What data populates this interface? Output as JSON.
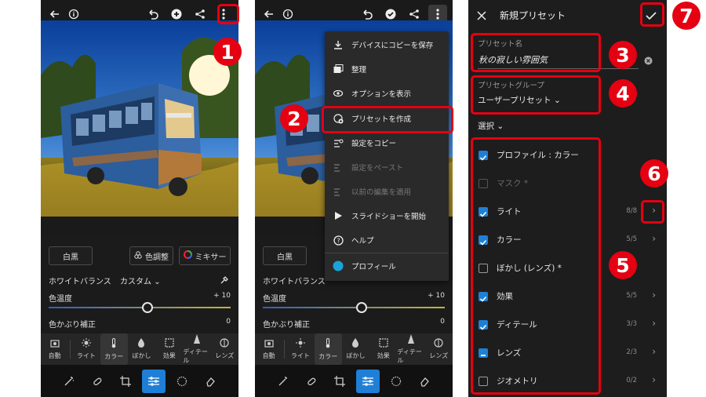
{
  "screen1": {
    "white_black_label": "白黒",
    "color_adjust_label": "色調整",
    "mixer_label": "ミキサー",
    "wb_label": "ホワイトバランス",
    "wb_value": "カスタム",
    "temp_label": "色温度",
    "temp_value": "+ 10",
    "tint_label": "色かぶり補正",
    "tint_value": "0",
    "tools": [
      "自動",
      "ライト",
      "カラー",
      "ぼかし",
      "効果",
      "ディテール",
      "レンズ"
    ]
  },
  "screen2": {
    "white_black_label": "白黒",
    "wb_label": "ホワイトバランス",
    "temp_label": "色温度",
    "temp_value": "+ 10",
    "tint_label": "色かぶり補正",
    "tint_value": "0",
    "tools": [
      "自動",
      "ライト",
      "カラー",
      "ぼかし",
      "効果",
      "ディテール",
      "レンズ"
    ],
    "menu": [
      {
        "label": "デバイスにコピーを保存",
        "icon": "download-icon",
        "enabled": true
      },
      {
        "label": "整理",
        "icon": "folders-icon",
        "enabled": true
      },
      {
        "label": "オプションを表示",
        "icon": "eye-gear-icon",
        "enabled": true
      },
      {
        "label": "プリセットを作成",
        "icon": "create-preset-icon",
        "enabled": true
      },
      {
        "label": "設定をコピー",
        "icon": "copy-settings-icon",
        "enabled": true
      },
      {
        "label": "設定をペースト",
        "icon": "paste-settings-icon",
        "enabled": false
      },
      {
        "label": "以前の編集を適用",
        "icon": "apply-previous-icon",
        "enabled": false
      },
      {
        "label": "スライドショーを開始",
        "icon": "play-icon",
        "enabled": true
      },
      {
        "label": "ヘルプ",
        "icon": "help-icon",
        "enabled": true
      },
      {
        "label": "プロフィール",
        "icon": "profile-avatar-icon",
        "enabled": true
      }
    ]
  },
  "screen3": {
    "title": "新規プリセット",
    "preset_name_label": "プリセット名",
    "preset_name_value": "秋の寂しい雰囲気",
    "preset_group_label": "プリセットグループ",
    "preset_group_value": "ユーザープリセット",
    "select_label": "選択",
    "rows": [
      {
        "label": "プロファイル : カラー",
        "state": "on",
        "count": "",
        "chevron": false
      },
      {
        "label": "マスク *",
        "state": "disabled",
        "count": "",
        "chevron": false
      },
      {
        "label": "ライト",
        "state": "on",
        "count": "8/8",
        "chevron": true
      },
      {
        "label": "カラー",
        "state": "on",
        "count": "5/5",
        "chevron": true
      },
      {
        "label": "ぼかし (レンズ) *",
        "state": "off",
        "count": "",
        "chevron": false
      },
      {
        "label": "効果",
        "state": "on",
        "count": "5/5",
        "chevron": true
      },
      {
        "label": "ディテール",
        "state": "on",
        "count": "3/3",
        "chevron": true
      },
      {
        "label": "レンズ",
        "state": "mixed",
        "count": "2/3",
        "chevron": true
      },
      {
        "label": "ジオメトリ",
        "state": "off",
        "count": "0/2",
        "chevron": true
      }
    ]
  },
  "badges": [
    "1",
    "2",
    "3",
    "4",
    "5",
    "6",
    "7"
  ],
  "colors": {
    "highlight": "#e50012",
    "accent": "#1f7fd6",
    "panel": "#1a1a1a"
  }
}
